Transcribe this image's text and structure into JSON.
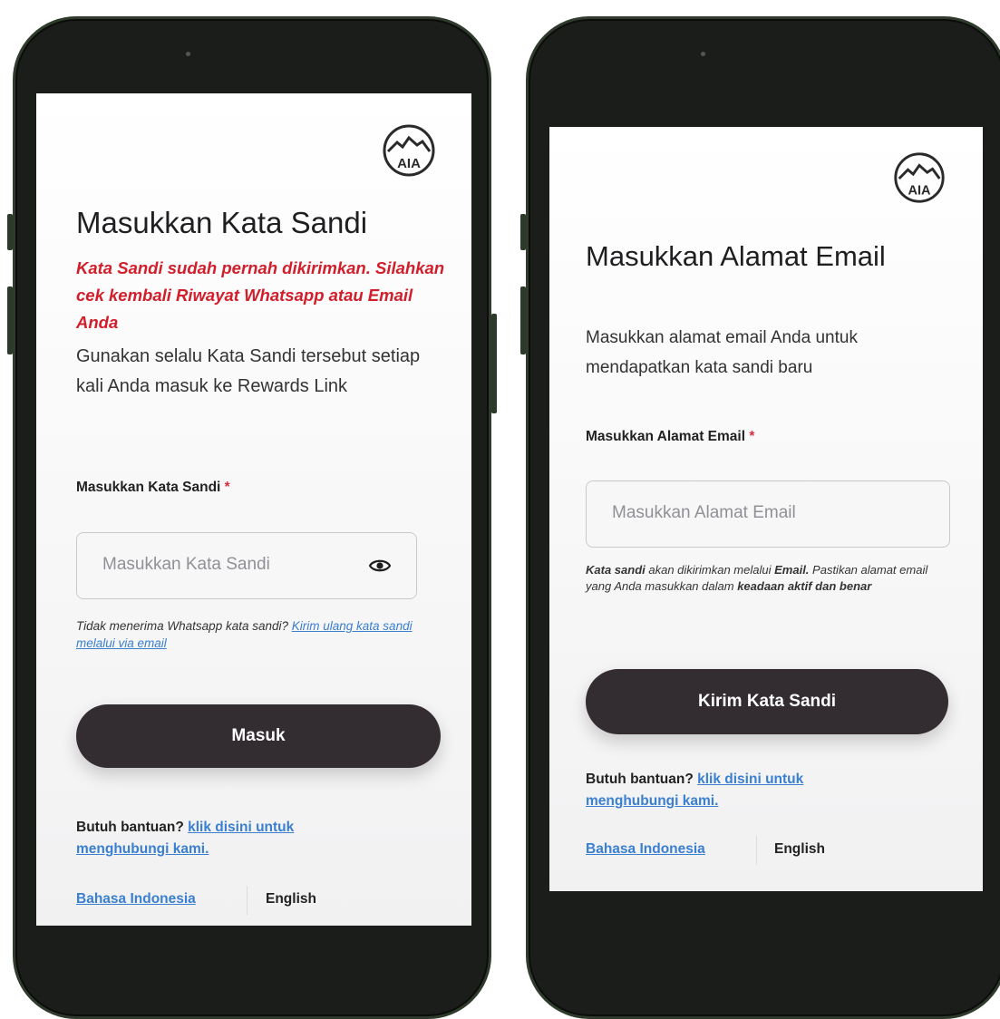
{
  "colors": {
    "frame": "#1b1d1a",
    "button": "#332c31",
    "warning": "#d21e2a",
    "link": "#3a7fd0",
    "required": "#d93040"
  },
  "left_screen": {
    "logo_text": "AIA",
    "title": "Masukkan Kata Sandi",
    "warning": "Kata Sandi sudah pernah dikirimkan. Silahkan cek kembali Riwayat Whatsapp atau Email Anda",
    "description": "Gunakan selalu Kata Sandi tersebut setiap kali Anda masuk ke Rewards Link",
    "field_label": "Masukkan Kata Sandi",
    "required_mark": "*",
    "input_placeholder": "Masukkan Kata Sandi",
    "toggle_icon": "eye-icon",
    "hint_text": "Tidak menerima Whatsapp kata sandi?",
    "hint_link": "Kirim ulang kata sandi melalui via email",
    "submit_label": "Masuk",
    "help_text": "Butuh bantuan?",
    "help_link": "klik disini untuk menghubungi kami.",
    "lang_id": "Bahasa Indonesia",
    "lang_en": "English"
  },
  "right_screen": {
    "logo_text": "AIA",
    "title": "Masukkan Alamat Email",
    "description": "Masukkan alamat email Anda untuk mendapatkan kata sandi baru",
    "field_label": "Masukkan Alamat Email",
    "required_mark": "*",
    "input_placeholder": "Masukkan Alamat Email",
    "note_part1": "Kata sandi",
    "note_part2": "akan dikirimkan melalui",
    "note_part3": "Email.",
    "note_part4": "Pastikan alamat email yang Anda masukkan dalam",
    "note_part5": "keadaan aktif dan benar",
    "submit_label": "Kirim Kata Sandi",
    "help_text": "Butuh bantuan?",
    "help_link": "klik disini untuk menghubungi kami.",
    "lang_id": "Bahasa Indonesia",
    "lang_en": "English"
  }
}
